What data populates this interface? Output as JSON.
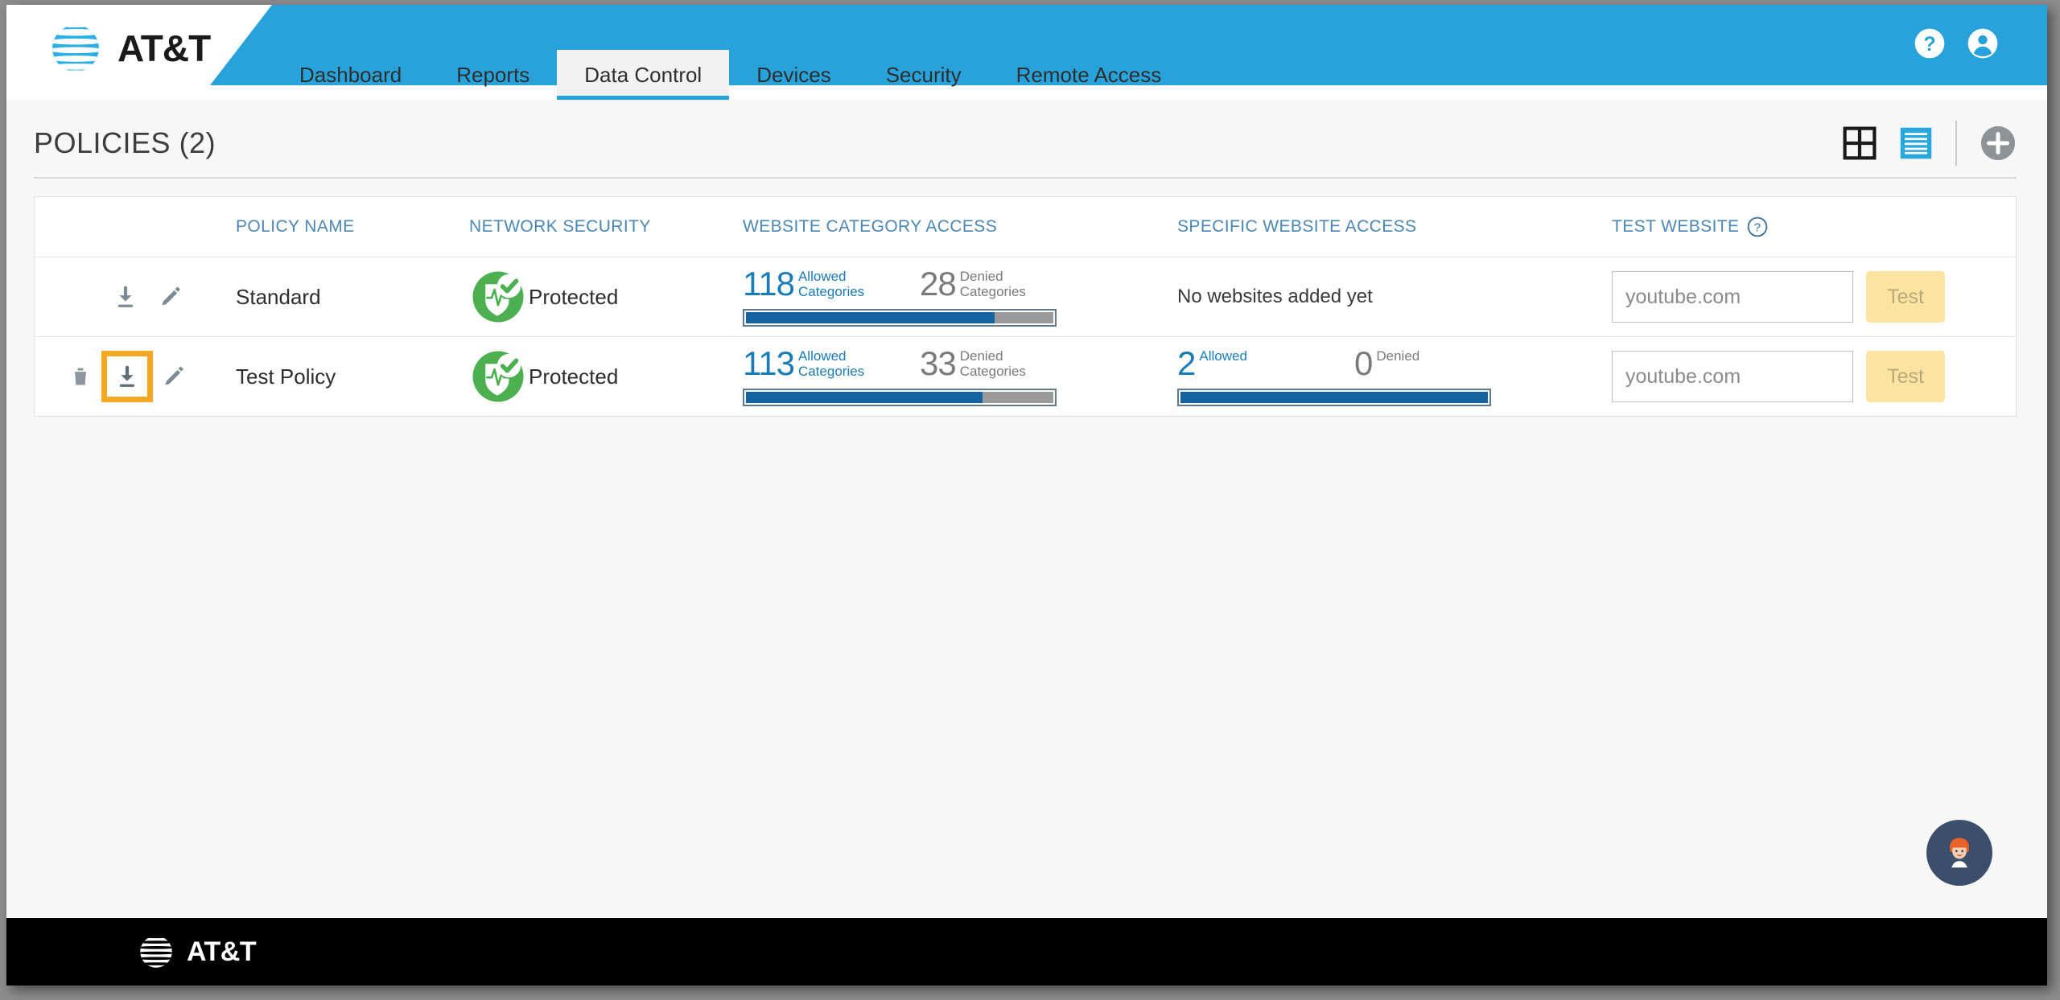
{
  "brand": {
    "name": "AT&T",
    "logo_icon": "att-globe-icon",
    "accent_blue": "#27a2db",
    "footer_bg": "#000000"
  },
  "header": {
    "help_icon": "help-circle-icon",
    "account_icon": "user-account-icon"
  },
  "nav": {
    "items": [
      {
        "label": "Dashboard",
        "active": false
      },
      {
        "label": "Reports",
        "active": false
      },
      {
        "label": "Data Control",
        "active": true
      },
      {
        "label": "Devices",
        "active": false
      },
      {
        "label": "Security",
        "active": false
      },
      {
        "label": "Remote Access",
        "active": false
      }
    ]
  },
  "page": {
    "title": "POLICIES (2)",
    "grid_view_icon": "grid-view-icon",
    "list_view_icon": "list-view-icon",
    "add_icon": "add-plus-icon",
    "active_view": "list"
  },
  "table": {
    "headers": {
      "actions": "",
      "policy_name": "POLICY NAME",
      "network_security": "NETWORK SECURITY",
      "website_category_access": "WEBSITE CATEGORY ACCESS",
      "specific_website_access": "SPECIFIC WEBSITE ACCESS",
      "test_website": "TEST WEBSITE",
      "test_website_help_icon": "help-circle-icon"
    },
    "rows": [
      {
        "name": "Standard",
        "has_delete": false,
        "delete_icon": "trash-icon",
        "download_icon": "download-icon",
        "edit_icon": "pencil-edit-icon",
        "download_highlighted": false,
        "security_icon": "shield-protected-icon",
        "security_status": "Protected",
        "category": {
          "allowed_value": "118",
          "allowed_label": "Allowed\nCategories",
          "denied_value": "28",
          "denied_label": "Denied\nCategories",
          "allowed_percent": 81
        },
        "specific": {
          "empty_text": "No websites added yet",
          "has_data": false
        },
        "test": {
          "input_value": "",
          "placeholder": "youtube.com",
          "button_label": "Test"
        }
      },
      {
        "name": "Test Policy",
        "has_delete": true,
        "delete_icon": "trash-icon",
        "download_icon": "download-icon",
        "edit_icon": "pencil-edit-icon",
        "download_highlighted": true,
        "highlight_color": "#f5a623",
        "security_icon": "shield-protected-icon",
        "security_status": "Protected",
        "category": {
          "allowed_value": "113",
          "allowed_label": "Allowed\nCategories",
          "denied_value": "33",
          "denied_label": "Denied\nCategories",
          "allowed_percent": 77
        },
        "specific": {
          "empty_text": "",
          "has_data": true,
          "allowed_value": "2",
          "allowed_label": "Allowed",
          "denied_value": "0",
          "denied_label": "Denied",
          "allowed_percent": 100
        },
        "test": {
          "input_value": "",
          "placeholder": "youtube.com",
          "button_label": "Test"
        }
      }
    ]
  },
  "chat": {
    "icon": "chat-agent-avatar-icon"
  },
  "footer": {
    "brand": "AT&T",
    "logo_icon": "att-globe-icon"
  }
}
